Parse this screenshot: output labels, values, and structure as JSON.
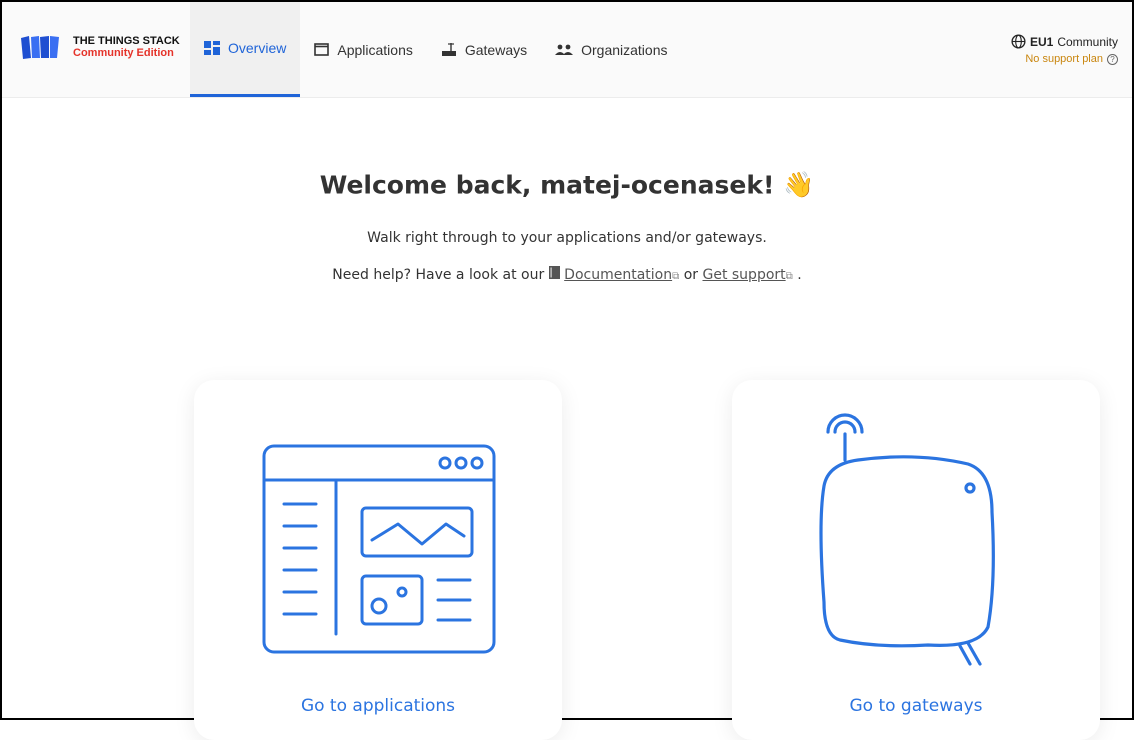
{
  "brand": {
    "title": "THE THINGS STACK",
    "subtitle": "Community Edition"
  },
  "nav": [
    {
      "label": "Overview",
      "icon": "grid-icon",
      "active": true
    },
    {
      "label": "Applications",
      "icon": "window-icon"
    },
    {
      "label": "Gateways",
      "icon": "gateway-icon"
    },
    {
      "label": "Organizations",
      "icon": "people-icon"
    }
  ],
  "region": {
    "name": "EU1",
    "label": "Community",
    "support": "No support plan"
  },
  "welcome": {
    "title": "Welcome back, matej-ocenasek!",
    "emoji": "👋"
  },
  "intro": "Walk right through to your applications and/or gateways.",
  "help": {
    "prefix": "Need help? Have a look at our",
    "docs_label": "Documentation",
    "or": "or",
    "support_label": "Get support",
    "suffix": "."
  },
  "cards": {
    "applications": "Go to applications",
    "gateways": "Go to gateways"
  },
  "colors": {
    "accent": "#1f64d8",
    "illustration": "#2b74e0",
    "brand_red": "#e5332a",
    "support": "#c9860f"
  }
}
